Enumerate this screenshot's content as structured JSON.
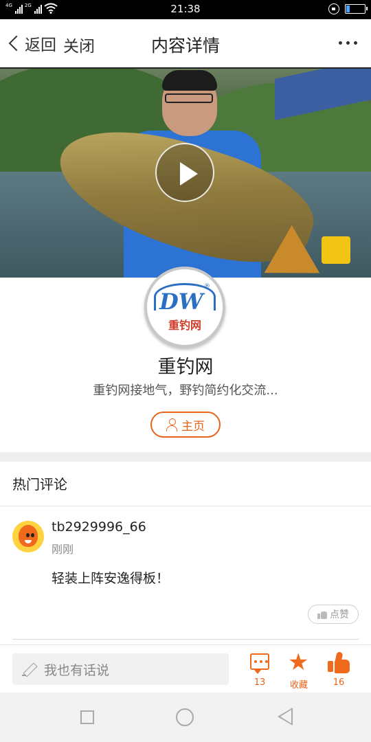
{
  "status_bar": {
    "time": "21:38",
    "signal_tags": [
      "4G",
      "2G"
    ],
    "icons": [
      "signal-icon",
      "signal-icon",
      "wifi-icon",
      "lock-rotation-icon",
      "battery-icon"
    ],
    "battery_level_fraction": 0.2
  },
  "nav": {
    "back_label": "返回",
    "close_label": "关闭",
    "title": "内容详情",
    "more_icon": "more-dots-icon"
  },
  "video": {
    "play_icon": "play-icon"
  },
  "profile": {
    "logo_text": "DW",
    "logo_cn": "重钓网",
    "logo_registered": "®",
    "name": "重钓网",
    "description": "重钓网接地气，野钓简约化交流...",
    "home_button_label": "主页",
    "home_icon": "person-icon"
  },
  "comments_section": {
    "title": "热门评论",
    "items": [
      {
        "username": "tb2929996_66",
        "time": "刚刚",
        "text": "轻装上阵安逸得板！",
        "like_label": "点赞"
      }
    ]
  },
  "bottom_bar": {
    "input_placeholder": "我也有话说",
    "comment_count": "13",
    "favorite_label": "收藏",
    "like_count": "16",
    "accent_color": "#f06a1e"
  },
  "system_nav": {
    "icons": [
      "recent-apps-icon",
      "home-icon",
      "back-icon"
    ]
  }
}
